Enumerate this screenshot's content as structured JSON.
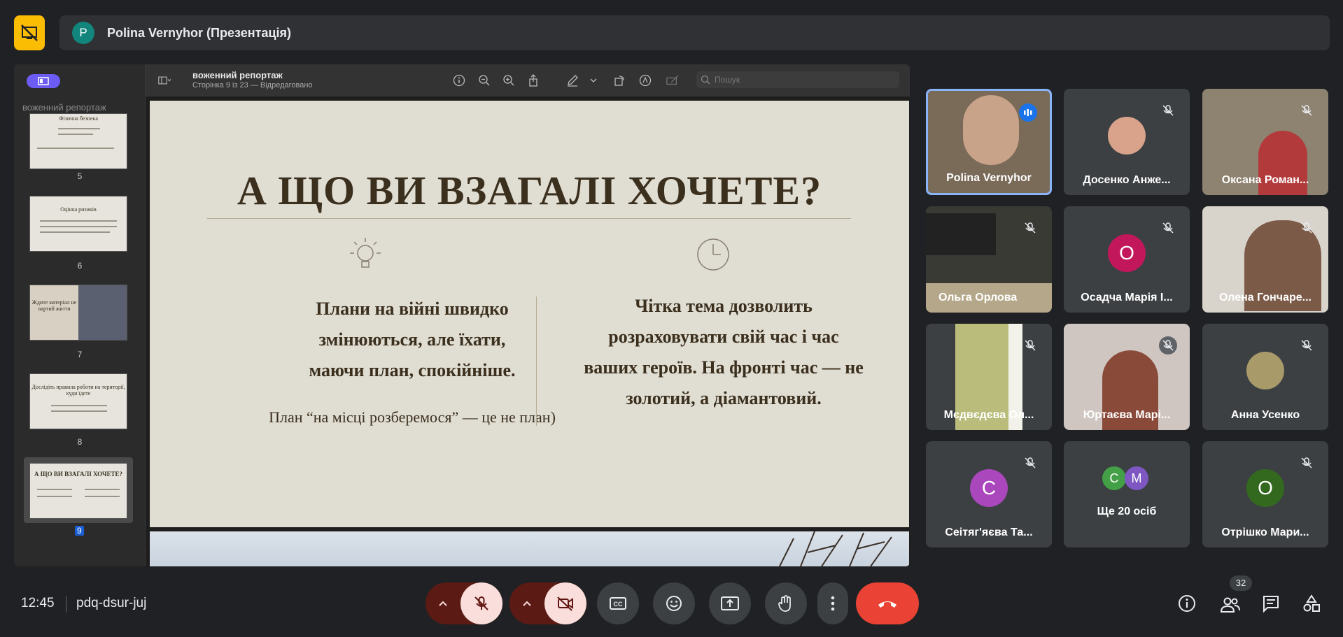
{
  "colors": {
    "accent_yellow": "#fbbc04",
    "end_call_red": "#ea4335",
    "muted_bg": "#f9dedc",
    "tile_bg": "#3c4043"
  },
  "presenter": {
    "initial": "P",
    "name": "Polina Vernyhor (Презентація)"
  },
  "presentation": {
    "sidebar_title": "воженний репортаж",
    "doc_title": "воженний репортаж",
    "doc_subtitle": "Сторінка 9 із 23 — Відредаговано",
    "search_placeholder": "Пошук",
    "thumbnails": [
      {
        "num": "5",
        "title": "Фізична безпека"
      },
      {
        "num": "6",
        "title": "Оцінка ризиків"
      },
      {
        "num": "7",
        "title": "Ждите матеріал не вартий життя"
      },
      {
        "num": "8",
        "title": "Дослідіть правила роботи на території, куди їдете"
      },
      {
        "num": "9",
        "title": "А ЩО ВИ ВЗАГАЛІ ХОЧЕТЕ?"
      }
    ],
    "slide": {
      "title": "А ЩО ВИ  ВЗАГАЛІ ХОЧЕТЕ?",
      "left_text": "Плани на війні швидко\nзмінюються, але їхати,\nмаючи план, спокійніше.",
      "left_note": "План “на місці розберемося” — це не план)",
      "right_text": "Чітка тема дозволить\nрозраховувати свій час і час\nваших героїв. На фронті час — не\nзолотий, а діамантовий."
    }
  },
  "participants": [
    {
      "name": "Polina Vernyhor",
      "kind": "video",
      "speaking": true
    },
    {
      "name": "Досенко Анже...",
      "kind": "photo",
      "muted": true
    },
    {
      "name": "Оксана Роман...",
      "kind": "video",
      "muted": true
    },
    {
      "name": "Ольга Орлова",
      "kind": "video",
      "muted": true
    },
    {
      "name": "Осадча Марія І...",
      "kind": "letter",
      "initial": "О",
      "color": "#c2185b",
      "muted": true
    },
    {
      "name": "Олена Гончаре...",
      "kind": "video",
      "muted": true
    },
    {
      "name": "Мєдвєдєва Ол...",
      "kind": "video",
      "muted": true
    },
    {
      "name": "Юртаєва Марі...",
      "kind": "video",
      "muted": true
    },
    {
      "name": "Анна Усенко",
      "kind": "photo",
      "muted": true
    },
    {
      "name": "Сеітяг'яєва Та...",
      "kind": "letter",
      "initial": "С",
      "color": "#ab47bc",
      "muted": true
    },
    {
      "name": "Ще 20 осіб",
      "kind": "more",
      "initials": [
        "С",
        "М"
      ],
      "colors": [
        "#43a047",
        "#7e57c2"
      ]
    },
    {
      "name": "Отрішко Мари...",
      "kind": "letter",
      "initial": "О",
      "color": "#33691e",
      "muted": true
    }
  ],
  "bottom": {
    "time": "12:45",
    "meeting_code": "pdq-dsur-juj",
    "people_count": "32"
  }
}
